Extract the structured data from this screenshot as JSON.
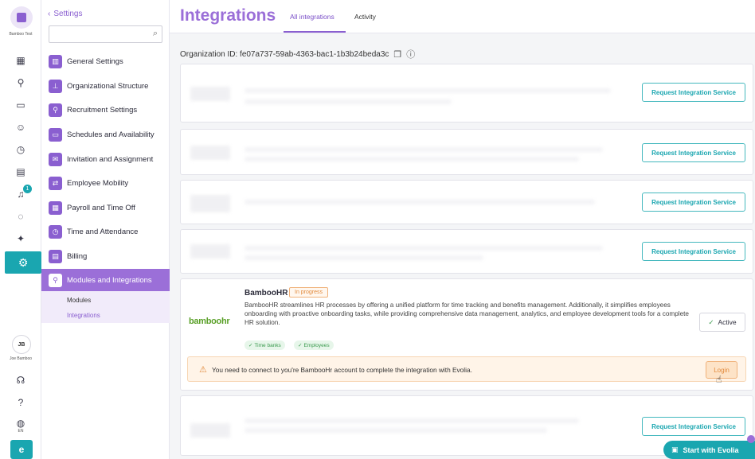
{
  "org": {
    "name": "Bamboo Test"
  },
  "user": {
    "initials": "JB",
    "name": "Joe Bamboo",
    "lang": "EN",
    "notifications": "1"
  },
  "rail_icons": [
    "dashboard-icon",
    "user-icon",
    "calendar-icon",
    "team-icon",
    "timer-icon",
    "inbox-icon",
    "bell-icon",
    "chat-icon",
    "party-icon",
    "gear-icon"
  ],
  "sidebar": {
    "back_label": "Settings",
    "search_placeholder": "",
    "items": [
      {
        "label": "General Settings",
        "icon": "building-icon"
      },
      {
        "label": "Organizational Structure",
        "icon": "org-chart-icon"
      },
      {
        "label": "Recruitment Settings",
        "icon": "recruit-icon"
      },
      {
        "label": "Schedules and Availability",
        "icon": "calendar-icon"
      },
      {
        "label": "Invitation and Assignment",
        "icon": "envelope-icon"
      },
      {
        "label": "Employee Mobility",
        "icon": "transfer-icon"
      },
      {
        "label": "Payroll and Time Off",
        "icon": "payroll-icon"
      },
      {
        "label": "Time and Attendance",
        "icon": "clock-icon"
      },
      {
        "label": "Billing",
        "icon": "billing-icon"
      },
      {
        "label": "Modules and Integrations",
        "icon": "integration-icon"
      }
    ],
    "sub_items": [
      {
        "label": "Modules"
      },
      {
        "label": "Integrations"
      }
    ]
  },
  "header": {
    "title": "Integrations",
    "tabs": [
      {
        "label": "All integrations"
      },
      {
        "label": "Activity"
      }
    ]
  },
  "org_id_label": "Organization ID: fe07a737-59ab-4363-bac1-1b3b24beda3c",
  "request_label": "Request Integration Service",
  "bamboo": {
    "logo_text": "bamboohr",
    "name": "BambooHR",
    "status": "In progress",
    "description": "BambooHR streamlines HR processes by offering a unified platform for time tracking and benefits management. Additionally, it simplifies employees onboarding with proactive onboarding tasks, while providing comprehensive data management, analytics, and employee development tools for a complete HR solution.",
    "tags": [
      "Time banks",
      "Employees"
    ],
    "active_label": "Active",
    "warning": "You need to connect to you're BambooHr account to complete the integration with Evolia.",
    "login_label": "Login"
  },
  "start_evolia": "Start with Evolia",
  "colors": {
    "accent": "#9b6fd8",
    "teal": "#1aa6b0",
    "warning": "#e28a3c"
  }
}
